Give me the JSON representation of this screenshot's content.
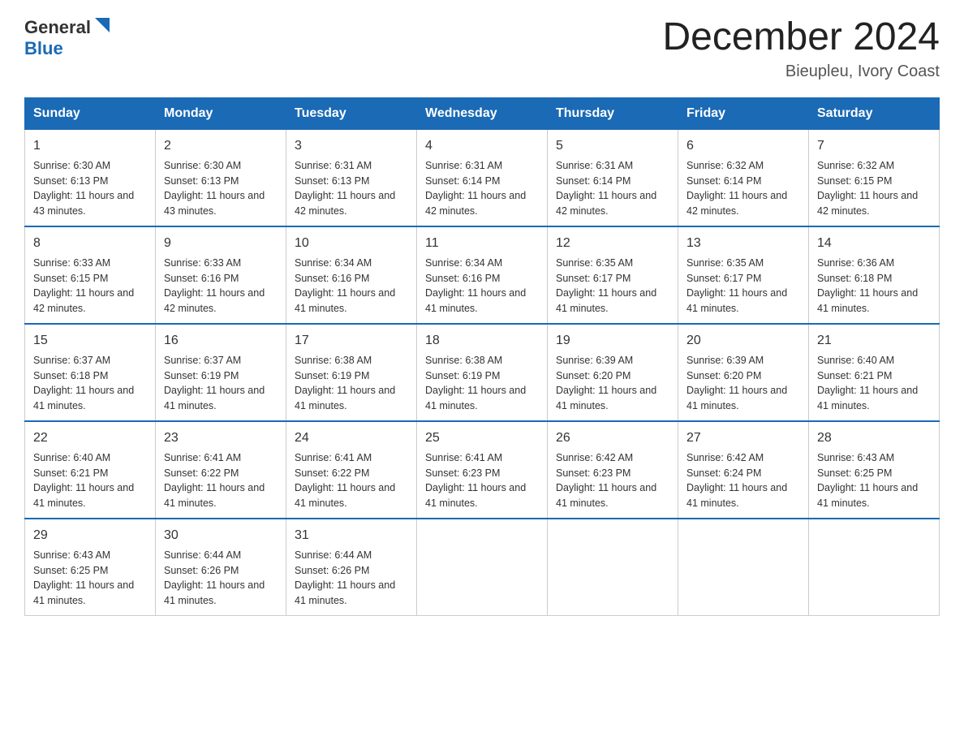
{
  "header": {
    "logo_general": "General",
    "logo_blue": "Blue",
    "month_title": "December 2024",
    "location": "Bieupleu, Ivory Coast"
  },
  "days_of_week": [
    "Sunday",
    "Monday",
    "Tuesday",
    "Wednesday",
    "Thursday",
    "Friday",
    "Saturday"
  ],
  "weeks": [
    [
      {
        "day": "1",
        "sunrise": "6:30 AM",
        "sunset": "6:13 PM",
        "daylight": "11 hours and 43 minutes."
      },
      {
        "day": "2",
        "sunrise": "6:30 AM",
        "sunset": "6:13 PM",
        "daylight": "11 hours and 43 minutes."
      },
      {
        "day": "3",
        "sunrise": "6:31 AM",
        "sunset": "6:13 PM",
        "daylight": "11 hours and 42 minutes."
      },
      {
        "day": "4",
        "sunrise": "6:31 AM",
        "sunset": "6:14 PM",
        "daylight": "11 hours and 42 minutes."
      },
      {
        "day": "5",
        "sunrise": "6:31 AM",
        "sunset": "6:14 PM",
        "daylight": "11 hours and 42 minutes."
      },
      {
        "day": "6",
        "sunrise": "6:32 AM",
        "sunset": "6:14 PM",
        "daylight": "11 hours and 42 minutes."
      },
      {
        "day": "7",
        "sunrise": "6:32 AM",
        "sunset": "6:15 PM",
        "daylight": "11 hours and 42 minutes."
      }
    ],
    [
      {
        "day": "8",
        "sunrise": "6:33 AM",
        "sunset": "6:15 PM",
        "daylight": "11 hours and 42 minutes."
      },
      {
        "day": "9",
        "sunrise": "6:33 AM",
        "sunset": "6:16 PM",
        "daylight": "11 hours and 42 minutes."
      },
      {
        "day": "10",
        "sunrise": "6:34 AM",
        "sunset": "6:16 PM",
        "daylight": "11 hours and 41 minutes."
      },
      {
        "day": "11",
        "sunrise": "6:34 AM",
        "sunset": "6:16 PM",
        "daylight": "11 hours and 41 minutes."
      },
      {
        "day": "12",
        "sunrise": "6:35 AM",
        "sunset": "6:17 PM",
        "daylight": "11 hours and 41 minutes."
      },
      {
        "day": "13",
        "sunrise": "6:35 AM",
        "sunset": "6:17 PM",
        "daylight": "11 hours and 41 minutes."
      },
      {
        "day": "14",
        "sunrise": "6:36 AM",
        "sunset": "6:18 PM",
        "daylight": "11 hours and 41 minutes."
      }
    ],
    [
      {
        "day": "15",
        "sunrise": "6:37 AM",
        "sunset": "6:18 PM",
        "daylight": "11 hours and 41 minutes."
      },
      {
        "day": "16",
        "sunrise": "6:37 AM",
        "sunset": "6:19 PM",
        "daylight": "11 hours and 41 minutes."
      },
      {
        "day": "17",
        "sunrise": "6:38 AM",
        "sunset": "6:19 PM",
        "daylight": "11 hours and 41 minutes."
      },
      {
        "day": "18",
        "sunrise": "6:38 AM",
        "sunset": "6:19 PM",
        "daylight": "11 hours and 41 minutes."
      },
      {
        "day": "19",
        "sunrise": "6:39 AM",
        "sunset": "6:20 PM",
        "daylight": "11 hours and 41 minutes."
      },
      {
        "day": "20",
        "sunrise": "6:39 AM",
        "sunset": "6:20 PM",
        "daylight": "11 hours and 41 minutes."
      },
      {
        "day": "21",
        "sunrise": "6:40 AM",
        "sunset": "6:21 PM",
        "daylight": "11 hours and 41 minutes."
      }
    ],
    [
      {
        "day": "22",
        "sunrise": "6:40 AM",
        "sunset": "6:21 PM",
        "daylight": "11 hours and 41 minutes."
      },
      {
        "day": "23",
        "sunrise": "6:41 AM",
        "sunset": "6:22 PM",
        "daylight": "11 hours and 41 minutes."
      },
      {
        "day": "24",
        "sunrise": "6:41 AM",
        "sunset": "6:22 PM",
        "daylight": "11 hours and 41 minutes."
      },
      {
        "day": "25",
        "sunrise": "6:41 AM",
        "sunset": "6:23 PM",
        "daylight": "11 hours and 41 minutes."
      },
      {
        "day": "26",
        "sunrise": "6:42 AM",
        "sunset": "6:23 PM",
        "daylight": "11 hours and 41 minutes."
      },
      {
        "day": "27",
        "sunrise": "6:42 AM",
        "sunset": "6:24 PM",
        "daylight": "11 hours and 41 minutes."
      },
      {
        "day": "28",
        "sunrise": "6:43 AM",
        "sunset": "6:25 PM",
        "daylight": "11 hours and 41 minutes."
      }
    ],
    [
      {
        "day": "29",
        "sunrise": "6:43 AM",
        "sunset": "6:25 PM",
        "daylight": "11 hours and 41 minutes."
      },
      {
        "day": "30",
        "sunrise": "6:44 AM",
        "sunset": "6:26 PM",
        "daylight": "11 hours and 41 minutes."
      },
      {
        "day": "31",
        "sunrise": "6:44 AM",
        "sunset": "6:26 PM",
        "daylight": "11 hours and 41 minutes."
      },
      null,
      null,
      null,
      null
    ]
  ],
  "labels": {
    "sunrise_prefix": "Sunrise: ",
    "sunset_prefix": "Sunset: ",
    "daylight_prefix": "Daylight: "
  }
}
